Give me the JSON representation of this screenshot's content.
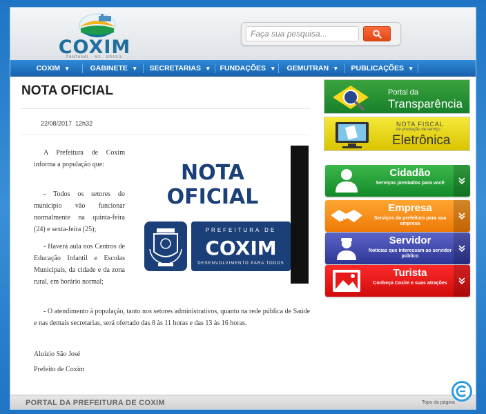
{
  "header": {
    "logo_text": "COXIM",
    "logo_sub": "PANTANAL · MS · BRASIL",
    "search_placeholder": "Faça sua pesquisa..."
  },
  "nav": {
    "items": [
      {
        "label": "COXIM"
      },
      {
        "label": "GABINETE"
      },
      {
        "label": "SECRETARIAS"
      },
      {
        "label": "FUNDAÇÕES"
      },
      {
        "label": "GEMUTRAN"
      },
      {
        "label": "PUBLICAÇÕES"
      }
    ],
    "dropdown_glyph": "▾"
  },
  "article": {
    "title": "NOTA OFICIAL",
    "date": "22/08/2017",
    "time": "12h32",
    "paragraphs": [
      "A Prefeitura de Coxim informa a população que:",
      "- Todos os setores do município vão funcionar normalmente na quinta-feira (24) e sexta-feira (25);",
      "- Haverá aula nos Centros de Educação Infantil e Escolas Municipais, da cidade e da zona rural, em horário normal;",
      "- O atendimento à população, tanto nos setores administrativos, quanto na rede pública de Saúde e nas demais secretarias, será ofertado das 8 às 11 horas e das 13 às 16 horas.",
      "Aluízio São José",
      "Prefeito de Coxim"
    ],
    "image": {
      "title": "NOTA OFICIAL",
      "pref_label": "PREFEITURA DE",
      "pref_city": "COXIM",
      "pref_slogan": "DESENVOLVIMENTO PARA TODOS"
    }
  },
  "sidebar": {
    "transparencia": {
      "small": "Portal da",
      "big": "Transparência"
    },
    "nota_fiscal": {
      "small": "NOTA FISCAL",
      "tiny": "de prestação de serviço",
      "big": "Eletrônica"
    },
    "services": [
      {
        "name": "Cidadão",
        "desc": "Serviços prestados para você",
        "icon": "person-icon"
      },
      {
        "name": "Empresa",
        "desc": "Serviços da prefeitura para sua empresa",
        "icon": "handshake-icon"
      },
      {
        "name": "Servidor",
        "desc": "Notícias que interessam ao servidor público",
        "icon": "worker-icon"
      },
      {
        "name": "Turista",
        "desc": "Conheça Coxim e suas atrações",
        "icon": "picture-icon"
      }
    ]
  },
  "footer": {
    "title": "PORTAL DA PREFEITURA DE COXIM",
    "top_link": "Topo da página"
  },
  "colors": {
    "nav": "#1f73c4",
    "transparencia": "#2a9235",
    "nota_fiscal": "#e8d81a",
    "cidadao": "#22a03a",
    "empresa": "#f58f1a",
    "servidor": "#414aae",
    "turista": "#e81919"
  }
}
